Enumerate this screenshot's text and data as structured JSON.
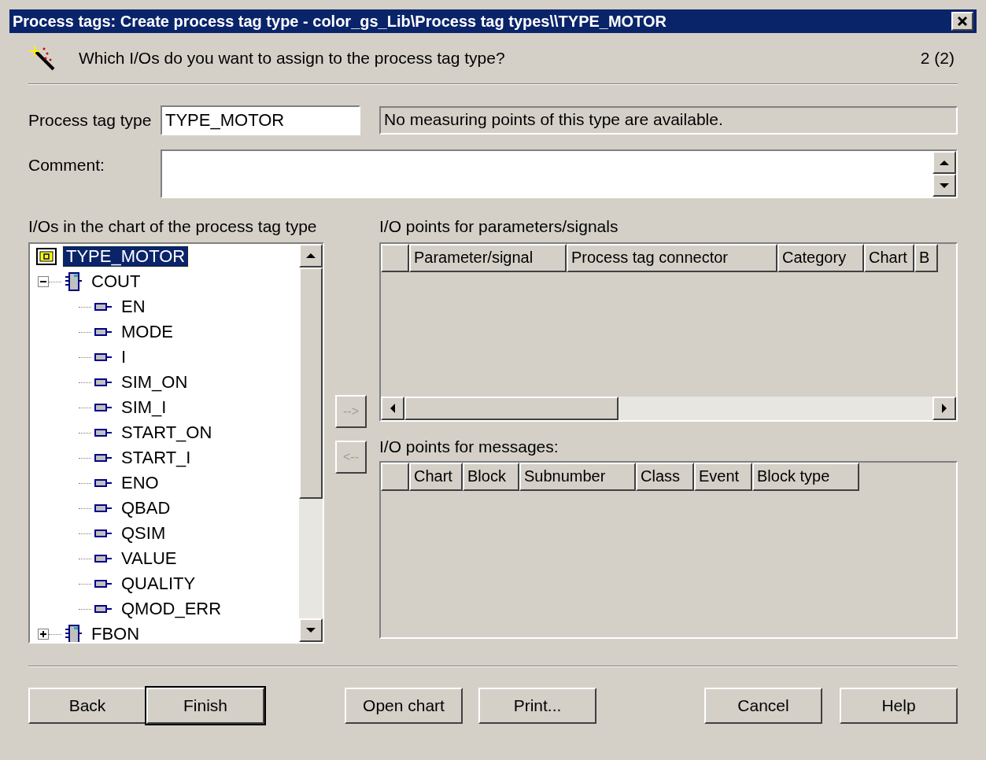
{
  "window": {
    "title": "Process tags: Create process tag type - color_gs_Lib\\Process tag types\\\\TYPE_MOTOR"
  },
  "question": "Which I/Os do you want to assign to the process tag type?",
  "page": "2 (2)",
  "type_field": {
    "label": "Process tag type",
    "value": "TYPE_MOTOR"
  },
  "status": "No measuring points of this type are available.",
  "comment": {
    "label": "Comment:"
  },
  "tree": {
    "label": "I/Os in the chart of the process tag type",
    "items": [
      {
        "label": "TYPE_MOTOR",
        "kind": "chart",
        "selected": true,
        "children": [
          {
            "label": "COUT",
            "kind": "block",
            "expanded": true,
            "selected": false,
            "children": [
              {
                "label": "EN",
                "kind": "io",
                "selected": false
              },
              {
                "label": "MODE",
                "kind": "io",
                "selected": false
              },
              {
                "label": "I",
                "kind": "io",
                "selected": false
              },
              {
                "label": "SIM_ON",
                "kind": "io",
                "selected": false
              },
              {
                "label": "SIM_I",
                "kind": "io",
                "selected": false
              },
              {
                "label": "START_ON",
                "kind": "io",
                "selected": false
              },
              {
                "label": "START_I",
                "kind": "io",
                "selected": false
              },
              {
                "label": "ENO",
                "kind": "io",
                "selected": false
              },
              {
                "label": "QBAD",
                "kind": "io",
                "selected": false
              },
              {
                "label": "QSIM",
                "kind": "io",
                "selected": false
              },
              {
                "label": "VALUE",
                "kind": "io",
                "selected": false
              },
              {
                "label": "QUALITY",
                "kind": "io",
                "selected": false
              },
              {
                "label": "QMOD_ERR",
                "kind": "io",
                "selected": false
              }
            ]
          },
          {
            "label": "FBON",
            "kind": "block",
            "expanded": false,
            "selected": false
          }
        ]
      }
    ]
  },
  "move_buttons": [
    {
      "label": "-->",
      "disabled": true
    },
    {
      "label": "<--",
      "disabled": true
    }
  ],
  "params_table": {
    "label": "I/O points for parameters/signals",
    "columns": [
      "Parameter/signal",
      "Process tag connector",
      "Category",
      "Chart",
      "B"
    ]
  },
  "messages_table": {
    "label": "I/O points for messages:",
    "columns": [
      "Chart",
      "Block",
      "Subnumber",
      "Class",
      "Event",
      "Block type"
    ]
  },
  "buttons": [
    {
      "label": "Back",
      "default": false
    },
    {
      "label": "Finish",
      "default": true
    },
    {
      "label": "Open chart",
      "default": false
    },
    {
      "label": "Print...",
      "default": false
    },
    {
      "label": "Cancel",
      "default": false
    },
    {
      "label": "Help",
      "default": false
    }
  ]
}
